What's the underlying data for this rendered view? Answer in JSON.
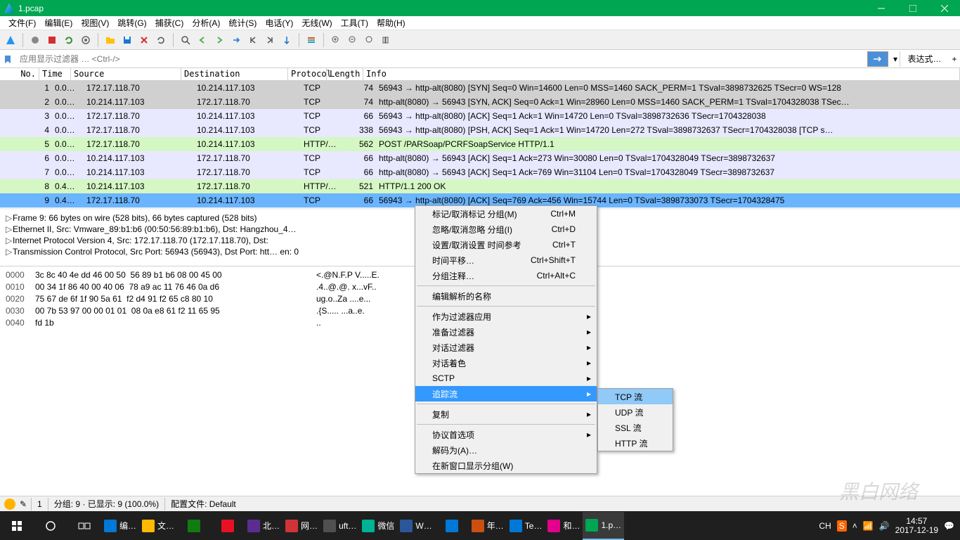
{
  "window": {
    "title": "1.pcap"
  },
  "menu": [
    "文件(F)",
    "编辑(E)",
    "视图(V)",
    "跳转(G)",
    "捕获(C)",
    "分析(A)",
    "统计(S)",
    "电话(Y)",
    "无线(W)",
    "工具(T)",
    "帮助(H)"
  ],
  "filter": {
    "placeholder": "应用显示过滤器 … <Ctrl-/>",
    "expression": "表达式…"
  },
  "columns": [
    "No.",
    "Time",
    "Source",
    "Destination",
    "Protocol",
    "Length",
    "Info"
  ],
  "packets": [
    {
      "no": "1",
      "time": "0.0…",
      "src": "172.17.118.70",
      "dst": "10.214.117.103",
      "proto": "TCP",
      "len": "74",
      "info": "56943 → http-alt(8080) [SYN] Seq=0 Win=14600 Len=0 MSS=1460 SACK_PERM=1 TSval=3898732625 TSecr=0 WS=128",
      "cls": "tcp-syn"
    },
    {
      "no": "2",
      "time": "0.0…",
      "src": "10.214.117.103",
      "dst": "172.17.118.70",
      "proto": "TCP",
      "len": "74",
      "info": "http-alt(8080) → 56943 [SYN, ACK] Seq=0 Ack=1 Win=28960 Len=0 MSS=1460 SACK_PERM=1 TSval=1704328038 TSec…",
      "cls": "tcp-syn"
    },
    {
      "no": "3",
      "time": "0.0…",
      "src": "172.17.118.70",
      "dst": "10.214.117.103",
      "proto": "TCP",
      "len": "66",
      "info": "56943 → http-alt(8080) [ACK] Seq=1 Ack=1 Win=14720 Len=0 TSval=3898732636 TSecr=1704328038",
      "cls": "tcp"
    },
    {
      "no": "4",
      "time": "0.0…",
      "src": "172.17.118.70",
      "dst": "10.214.117.103",
      "proto": "TCP",
      "len": "338",
      "info": "56943 → http-alt(8080) [PSH, ACK] Seq=1 Ack=1 Win=14720 Len=272 TSval=3898732637 TSecr=1704328038 [TCP s…",
      "cls": "tcp"
    },
    {
      "no": "5",
      "time": "0.0…",
      "src": "172.17.118.70",
      "dst": "10.214.117.103",
      "proto": "HTTP/…",
      "len": "562",
      "info": "POST /PARSoap/PCRFSoapService HTTP/1.1",
      "cls": "http"
    },
    {
      "no": "6",
      "time": "0.0…",
      "src": "10.214.117.103",
      "dst": "172.17.118.70",
      "proto": "TCP",
      "len": "66",
      "info": "http-alt(8080) → 56943 [ACK] Seq=1 Ack=273 Win=30080 Len=0 TSval=1704328049 TSecr=3898732637",
      "cls": "tcp"
    },
    {
      "no": "7",
      "time": "0.0…",
      "src": "10.214.117.103",
      "dst": "172.17.118.70",
      "proto": "TCP",
      "len": "66",
      "info": "http-alt(8080) → 56943 [ACK] Seq=1 Ack=769 Win=31104 Len=0 TSval=1704328049 TSecr=3898732637",
      "cls": "tcp"
    },
    {
      "no": "8",
      "time": "0.4…",
      "src": "10.214.117.103",
      "dst": "172.17.118.70",
      "proto": "HTTP/…",
      "len": "521",
      "info": "HTTP/1.1 200 OK",
      "cls": "http"
    },
    {
      "no": "9",
      "time": "0.4…",
      "src": "172.17.118.70",
      "dst": "10.214.117.103",
      "proto": "TCP",
      "len": "66",
      "info": "56943 → http-alt(8080) [ACK] Seq=769 Ack=456 Win=15744 Len=0 TSval=3898733073 TSecr=1704328475",
      "cls": "selected last"
    }
  ],
  "details": [
    "Frame 9: 66 bytes on wire (528 bits), 66 bytes captured (528 bits)",
    "Ethernet II, Src: Vmware_89:b1:b6 (00:50:56:89:b1:b6), Dst: Hangzhou_4…",
    "Internet Protocol Version 4, Src: 172.17.118.70 (172.17.118.70), Dst:",
    "Transmission Control Protocol, Src Port: 56943 (56943), Dst Port: htt…                     en: 0"
  ],
  "hex": [
    {
      "off": "0000",
      "b": "3c 8c 40 4e dd 46 00 50  56 89 b1 b6 08 00 45 00",
      "a": "<.@N.F.P V.....E."
    },
    {
      "off": "0010",
      "b": "00 34 1f 86 40 00 40 06  78 a9 ac 11 76 46 0a d6",
      "a": ".4..@.@. x...vF.."
    },
    {
      "off": "0020",
      "b": "75 67 de 6f 1f 90 5a 61  f2 d4 91 f2 65 c8 80 10",
      "a": "ug.o..Za ....e..."
    },
    {
      "off": "0030",
      "b": "00 7b 53 97 00 00 01 01  08 0a e8 61 f2 11 65 95",
      "a": ".{S..... ...a..e."
    },
    {
      "off": "0040",
      "b": "fd 1b                                           ",
      "a": ".."
    }
  ],
  "context": [
    {
      "label": "标记/取消标记 分组(M)",
      "shortcut": "Ctrl+M"
    },
    {
      "label": "忽略/取消忽略 分组(I)",
      "shortcut": "Ctrl+D"
    },
    {
      "label": "设置/取消设置 时间参考",
      "shortcut": "Ctrl+T"
    },
    {
      "label": "时间平移…",
      "shortcut": "Ctrl+Shift+T"
    },
    {
      "label": "分组注释…",
      "shortcut": "Ctrl+Alt+C"
    },
    {
      "sep": true
    },
    {
      "label": "编辑解析的名称"
    },
    {
      "sep": true
    },
    {
      "label": "作为过滤器应用",
      "sub": true
    },
    {
      "label": "准备过滤器",
      "sub": true
    },
    {
      "label": "对话过滤器",
      "sub": true
    },
    {
      "label": "对话着色",
      "sub": true
    },
    {
      "label": "SCTP",
      "sub": true
    },
    {
      "label": "追踪流",
      "sub": true,
      "highlighted": true
    },
    {
      "sep": true
    },
    {
      "label": "复制",
      "sub": true
    },
    {
      "sep": true
    },
    {
      "label": "协议首选项",
      "sub": true
    },
    {
      "label": "解码为(A)…"
    },
    {
      "label": "在新窗口显示分组(W)"
    }
  ],
  "submenu": [
    {
      "label": "TCP 流",
      "highlighted": true
    },
    {
      "label": "UDP 流"
    },
    {
      "label": "SSL 流"
    },
    {
      "label": "HTTP 流"
    }
  ],
  "status": {
    "left": "1",
    "pkts": "分组: 9 · 已显示: 9 (100.0%)",
    "profile": "配置文件: Default"
  },
  "taskbar": {
    "items": [
      "编…",
      "文…",
      "",
      "",
      "北…",
      "网…",
      "uft…",
      "微信",
      "W…",
      "",
      "年…",
      "Te…",
      "和…",
      "1.p…"
    ],
    "clock": "14:57",
    "date": "2017-12-19"
  }
}
